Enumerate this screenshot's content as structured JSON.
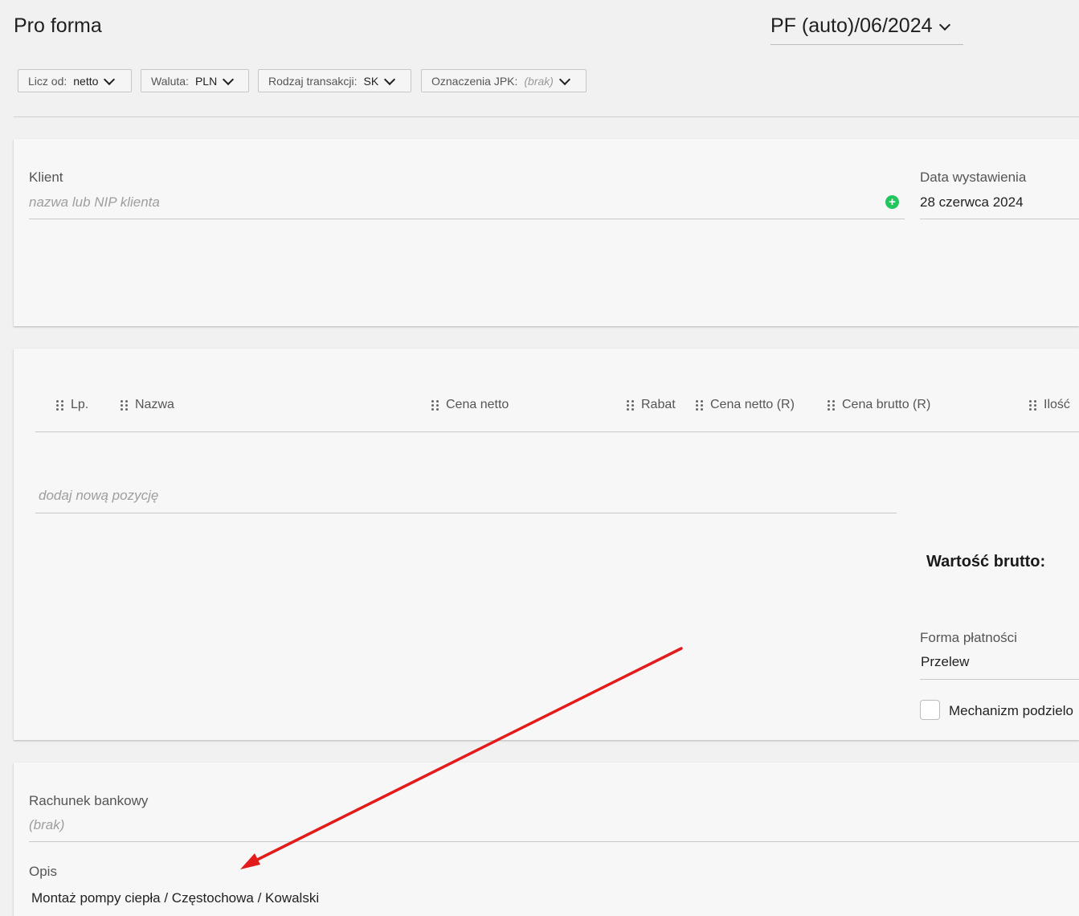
{
  "header": {
    "title": "Pro forma",
    "document_number": "PF (auto)/06/2024"
  },
  "filters": [
    {
      "label": "Licz od:",
      "value": "netto"
    },
    {
      "label": "Waluta:",
      "value": "PLN"
    },
    {
      "label": "Rodzaj transakcji:",
      "value": "SK"
    },
    {
      "label": "Oznaczenia JPK:",
      "value": "(brak)"
    }
  ],
  "client": {
    "label": "Klient",
    "placeholder": "nazwa lub NIP klienta"
  },
  "issue_date": {
    "label": "Data wystawienia",
    "value": "28 czerwca 2024"
  },
  "items_table": {
    "columns": [
      "Lp.",
      "Nazwa",
      "Cena netto",
      "Rabat",
      "Cena netto (R)",
      "Cena brutto (R)",
      "Ilość"
    ],
    "add_item_placeholder": "dodaj nową pozycję"
  },
  "summary": {
    "gross_value_label": "Wartość brutto:"
  },
  "payment": {
    "label": "Forma płatności",
    "value": "Przelew",
    "split_payment_label": "Mechanizm podzielo"
  },
  "bank_account": {
    "label": "Rachunek bankowy",
    "value": "(brak)"
  },
  "description": {
    "label": "Opis",
    "value": "Montaż pompy ciepła / Częstochowa / Kowalski"
  },
  "annotation": {
    "arrow_color": "#e31b1b"
  }
}
